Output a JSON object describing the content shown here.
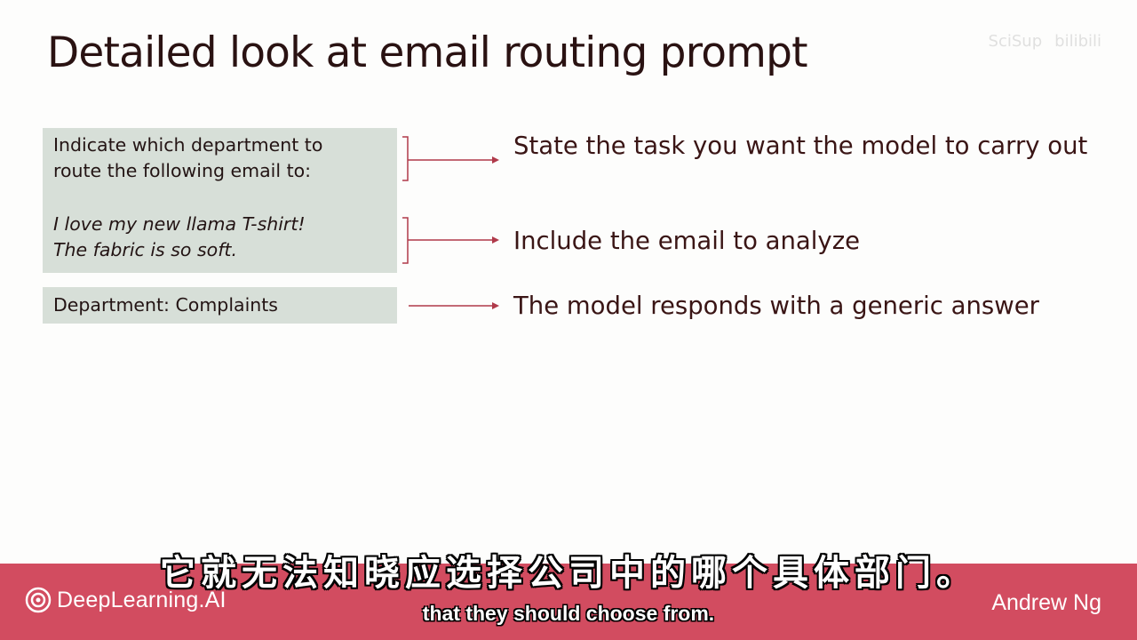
{
  "slide": {
    "title": "Detailed look at email routing prompt",
    "watermark": [
      "SciSup",
      "bilibili"
    ]
  },
  "prompt": {
    "instruction": "Indicate which department to\nroute the following email to:",
    "email": "I love my new llama T-shirt!\nThe fabric is so soft.",
    "response": "Department: Complaints"
  },
  "annotations": [
    {
      "text": "State the task you want the model to carry out"
    },
    {
      "text": "Include the email to analyze"
    },
    {
      "text": "The model responds with a generic answer"
    }
  ],
  "footer": {
    "logo_text": "DeepLearning.AI",
    "presenter": "Andrew Ng",
    "bar_color": "#d24c60"
  },
  "subtitles": {
    "zh": "它就无法知晓应选择公司中的哪个具体部门。",
    "en": "that they should choose from."
  },
  "colors": {
    "arrow": "#b03a4a",
    "box": "#d7dfd8",
    "title": "#2a1212"
  }
}
